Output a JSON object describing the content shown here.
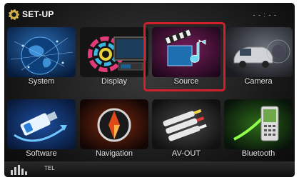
{
  "header": {
    "title": "SET-UP",
    "clock": "- - : - -",
    "icon": "gear-icon"
  },
  "menu": {
    "tiles": [
      {
        "label": "System",
        "icon": "globe-icon"
      },
      {
        "label": "Display",
        "icon": "display-icon"
      },
      {
        "label": "Source",
        "icon": "clapperboard-music-icon",
        "selected": true
      },
      {
        "label": "Camera",
        "icon": "car-camera-icon"
      },
      {
        "label": "Software",
        "icon": "usb-drive-icon"
      },
      {
        "label": "Navigation",
        "icon": "compass-icon"
      },
      {
        "label": "AV-OUT",
        "icon": "av-plug-icon"
      },
      {
        "label": "Bluetooth",
        "icon": "phone-icon"
      }
    ]
  },
  "bottombar": {
    "tel": "TEL",
    "eq_icon": "equalizer-icon"
  },
  "colors": {
    "highlight": "#d2202a",
    "gear": "#d2b24a"
  }
}
